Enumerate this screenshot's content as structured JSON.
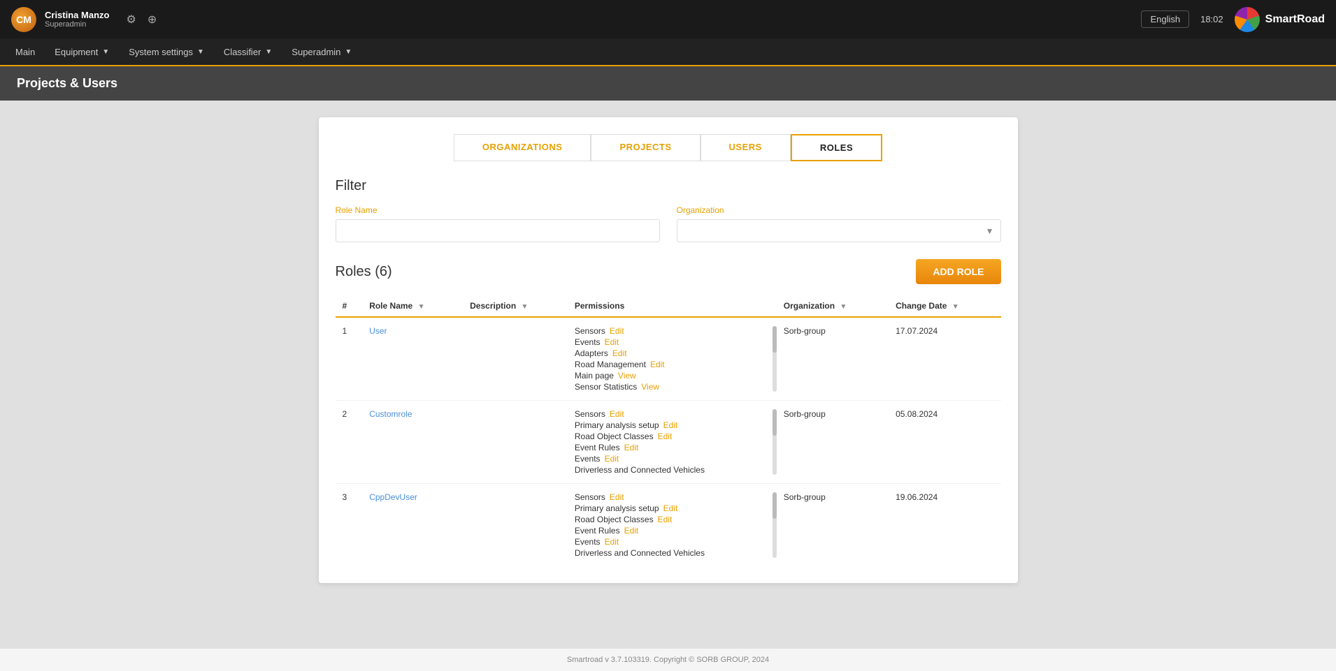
{
  "topbar": {
    "user_name": "Cristina Manzo",
    "user_role": "Superadmin",
    "user_initials": "CM",
    "time": "18:02",
    "language": "English",
    "brand_name": "SmartRoad"
  },
  "nav": {
    "items": [
      {
        "label": "Main",
        "active": false
      },
      {
        "label": "Equipment",
        "has_dropdown": true,
        "active": false
      },
      {
        "label": "System settings",
        "has_dropdown": true,
        "active": false
      },
      {
        "label": "Classifier",
        "has_dropdown": true,
        "active": false
      },
      {
        "label": "Superadmin",
        "has_dropdown": true,
        "active": false
      }
    ]
  },
  "page_header": "Projects & Users",
  "tabs": [
    {
      "label": "ORGANIZATIONS",
      "active": false
    },
    {
      "label": "PROJECTS",
      "active": false
    },
    {
      "label": "USERS",
      "active": false
    },
    {
      "label": "ROLES",
      "active": true
    }
  ],
  "filter": {
    "title": "Filter",
    "role_name_label": "Role Name",
    "role_name_placeholder": "",
    "organization_label": "Organization",
    "organization_placeholder": ""
  },
  "roles_section": {
    "title": "Roles",
    "count": 6,
    "add_button_label": "ADD ROLE"
  },
  "table": {
    "columns": [
      {
        "label": "#"
      },
      {
        "label": "Role Name",
        "sortable": true
      },
      {
        "label": "Description",
        "sortable": true
      },
      {
        "label": "Permissions"
      },
      {
        "label": "Organization",
        "sortable": true
      },
      {
        "label": "Change Date",
        "sortable": true
      }
    ],
    "rows": [
      {
        "number": 1,
        "role_name": "User",
        "description": "",
        "permissions": [
          {
            "name": "Sensors",
            "action": "Edit"
          },
          {
            "name": "Events",
            "action": "Edit"
          },
          {
            "name": "Adapters",
            "action": "Edit"
          },
          {
            "name": "Road Management",
            "action": "Edit"
          },
          {
            "name": "Main page",
            "action": "View"
          },
          {
            "name": "Sensor Statistics",
            "action": "View"
          }
        ],
        "organization": "Sorb-group",
        "change_date": "17.07.2024"
      },
      {
        "number": 2,
        "role_name": "Customrole",
        "description": "",
        "permissions": [
          {
            "name": "Sensors",
            "action": "Edit"
          },
          {
            "name": "Primary analysis setup",
            "action": "Edit"
          },
          {
            "name": "Road Object Classes",
            "action": "Edit"
          },
          {
            "name": "Event Rules",
            "action": "Edit"
          },
          {
            "name": "Events",
            "action": "Edit"
          },
          {
            "name": "Driverless and Connected Vehicles",
            "action": ""
          }
        ],
        "organization": "Sorb-group",
        "change_date": "05.08.2024"
      },
      {
        "number": 3,
        "role_name": "CppDevUser",
        "description": "",
        "permissions": [
          {
            "name": "Sensors",
            "action": "Edit"
          },
          {
            "name": "Primary analysis setup",
            "action": "Edit"
          },
          {
            "name": "Road Object Classes",
            "action": "Edit"
          },
          {
            "name": "Event Rules",
            "action": "Edit"
          },
          {
            "name": "Events",
            "action": "Edit"
          },
          {
            "name": "Driverless and Connected Vehicles",
            "action": ""
          }
        ],
        "organization": "Sorb-group",
        "change_date": "19.06.2024"
      }
    ]
  },
  "footer": {
    "text": "Smartroad v 3.7.103319. Copyright © SORB GROUP, 2024"
  }
}
